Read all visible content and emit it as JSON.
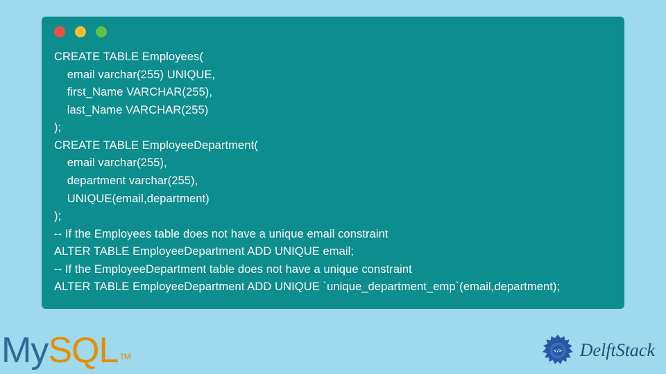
{
  "traffic_lights": [
    "red",
    "yellow",
    "green"
  ],
  "code": "CREATE TABLE Employees(\n    email varchar(255) UNIQUE,\n    first_Name VARCHAR(255),\n    last_Name VARCHAR(255)\n);\nCREATE TABLE EmployeeDepartment(\n    email varchar(255),\n    department varchar(255),\n    UNIQUE(email,department)\n);\n-- If the Employees table does not have a unique email constraint\nALTER TABLE EmployeeDepartment ADD UNIQUE email;\n-- If the EmployeeDepartment table does not have a unique constraint\nALTER TABLE EmployeeDepartment ADD UNIQUE `unique_department_emp`(email,department);",
  "mysql": {
    "my": "My",
    "sql": "SQL",
    "tm": "TM"
  },
  "delft": {
    "text": "DelftStack"
  }
}
